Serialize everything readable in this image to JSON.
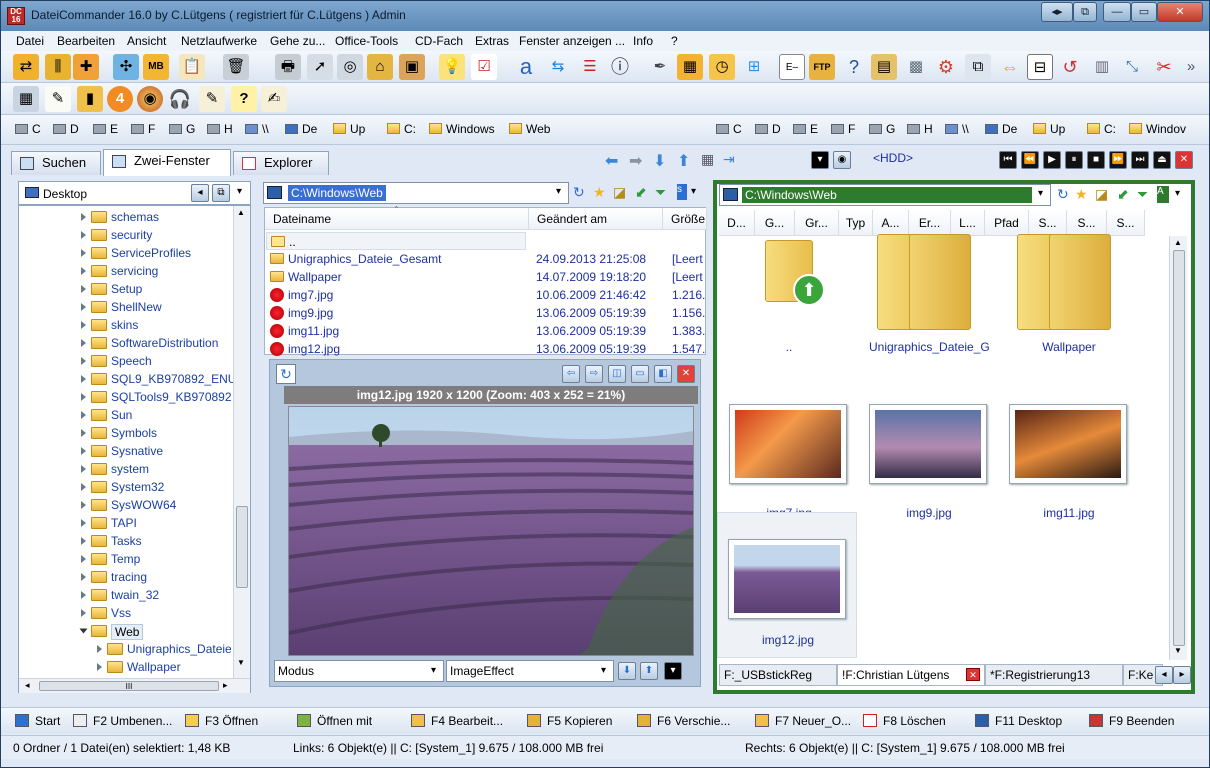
{
  "window": {
    "title": "DateiCommander 16.0   by C.Lütgens ( registriert für C.Lütgens ) Admin",
    "app_icon": "DC 16"
  },
  "menu": [
    "Datei",
    "Bearbeiten",
    "Ansicht",
    "Netzlaufwerke",
    "Gehe zu...",
    "Office-Tools",
    "CD-Fach",
    "Extras",
    "Fenster anzeigen ...",
    "Info",
    "?"
  ],
  "drives_left": [
    "C",
    "D",
    "E",
    "F",
    "G",
    "H",
    "\\\\",
    "De",
    "Up",
    "C:",
    "Windows",
    "Web"
  ],
  "drives_right": [
    "C",
    "D",
    "E",
    "F",
    "G",
    "H",
    "\\\\",
    "De",
    "Up",
    "C:",
    "Windov"
  ],
  "tabs": [
    "Suchen",
    "Zwei-Fenster",
    "Explorer"
  ],
  "hdd_label": "<HDD>",
  "tree": {
    "root": "Desktop",
    "items": [
      "schemas",
      "security",
      "ServiceProfiles",
      "servicing",
      "Setup",
      "ShellNew",
      "skins",
      "SoftwareDistribution",
      "Speech",
      "SQL9_KB970892_ENU",
      "SQLTools9_KB970892",
      "Sun",
      "Symbols",
      "Sysnative",
      "system",
      "System32",
      "SysWOW64",
      "TAPI",
      "Tasks",
      "Temp",
      "tracing",
      "twain_32",
      "Vss",
      "Web"
    ],
    "children": [
      "Unigraphics_Dateie_",
      "Wallpaper"
    ],
    "hscroll_label": "III"
  },
  "left_panel": {
    "path": "C:\\Windows\\Web",
    "columns": [
      "Dateiname",
      "Geändert am",
      "Größe"
    ],
    "rows": [
      {
        "name": "..",
        "date": "",
        "size": ""
      },
      {
        "name": "Unigraphics_Dateie_Gesamt",
        "date": "24.09.2013 21:25:08",
        "size": "[Leert"
      },
      {
        "name": "Wallpaper",
        "date": "14.07.2009 19:18:20",
        "size": "[Leert"
      },
      {
        "name": "img7.jpg",
        "date": "10.06.2009 21:46:42",
        "size": "1.216."
      },
      {
        "name": "img9.jpg",
        "date": "13.06.2009 05:19:39",
        "size": "1.156."
      },
      {
        "name": "img11.jpg",
        "date": "13.06.2009 05:19:39",
        "size": "1.383."
      },
      {
        "name": "img12.jpg",
        "date": "13.06.2009 05:19:39",
        "size": "1.547."
      }
    ],
    "viewer_caption": "img12.jpg 1920 x 1200 (Zoom: 403 x 252 = 21%)",
    "modus": "Modus",
    "effect": "ImageEffect"
  },
  "right_panel": {
    "path": "C:\\Windows\\Web",
    "columns": [
      "D...",
      "G...",
      "Gr...",
      "Typ",
      "A...",
      "Er...",
      "L...",
      "Pfad",
      "S...",
      "S...",
      "S..."
    ],
    "thumbs": [
      "..",
      "Unigraphics_Dateie_G...",
      "Wallpaper",
      "img7.jpg",
      "img9.jpg",
      "img11.jpg",
      "img12.jpg"
    ],
    "bottom_tabs": [
      "F:_USBstickReg",
      "!F:Christian Lütgens",
      "*F:Registrierung13",
      "F:Ke"
    ]
  },
  "fkeys": [
    "Start",
    "F2 Umbenen...",
    "F3  Öffnen",
    "Öffnen mit",
    "F4  Bearbeit...",
    "F5  Kopieren",
    "F6  Verschie...",
    "F7  Neuer_O...",
    "F8  Löschen",
    "F11 Desktop",
    "F9  Beenden"
  ],
  "status": {
    "left": "0 Ordner / 1 Datei(en) selektiert: 1,48 KB",
    "mid": "Links: 6  Objekt(e)   ||  C: [System_1]  9.675 / 108.000 MB frei",
    "right": "Rechts: 6  Objekt(e)   ||  C: [System_1]  9.675 / 108.000 MB frei"
  },
  "colors": {
    "right_border": "#2e7a2e",
    "path_highlight": "#3a6fd1",
    "link_text": "#1c2fa0"
  }
}
